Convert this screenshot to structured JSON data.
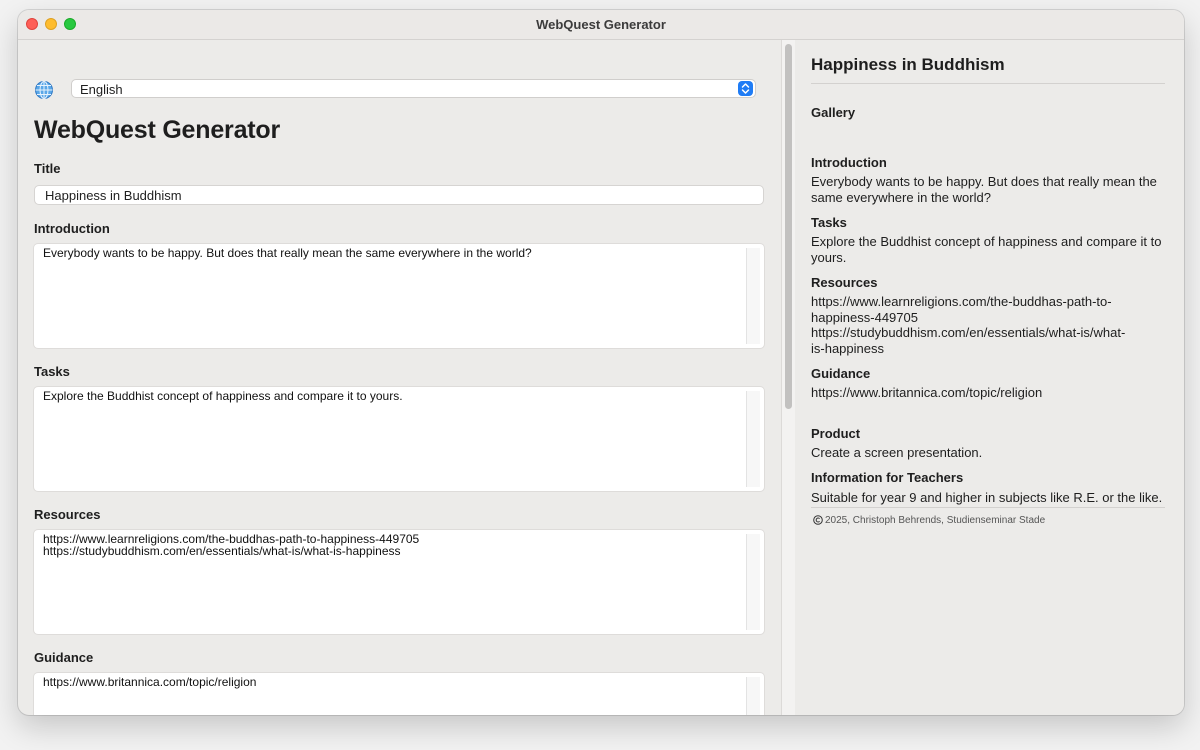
{
  "window": {
    "title": "WebQuest Generator"
  },
  "language": {
    "selected": "English"
  },
  "form": {
    "heading": "WebQuest Generator",
    "title_label": "Title",
    "title_value": "Happiness in Buddhism",
    "introduction_label": "Introduction",
    "introduction_value": "Everybody wants to be happy. But does that really mean the same everywhere in the world?",
    "tasks_label": "Tasks",
    "tasks_value": "Explore the Buddhist concept of happiness and compare it to yours.",
    "resources_label": "Resources",
    "resources_value": "https://www.learnreligions.com/the-buddhas-path-to-happiness-449705\nhttps://studybuddhism.com/en/essentials/what-is/what-is-happiness",
    "guidance_label": "Guidance",
    "guidance_value": "https://www.britannica.com/topic/religion"
  },
  "preview": {
    "title": "Happiness in Buddhism",
    "gallery_heading": "Gallery",
    "introduction_heading": "Introduction",
    "introduction_text": "Everybody wants to be happy. But does that really mean the same everywhere in the world?",
    "tasks_heading": "Tasks",
    "tasks_text": "Explore the Buddhist concept of happiness and compare it to yours.",
    "resources_heading": "Resources",
    "resources_line1": "https://www.learnreligions.com/the-buddhas-path-to-",
    "resources_line2": "happiness-449705",
    "resources_line3": "https://studybuddhism.com/en/essentials/what-is/what-",
    "resources_line4": "is-happiness",
    "guidance_heading": "Guidance",
    "guidance_text": "https://www.britannica.com/topic/religion",
    "product_heading": "Product",
    "product_text": "Create a screen presentation.",
    "teachers_heading": "Information for Teachers",
    "teachers_text": "Suitable for year 9 and higher in subjects like R.E. or the like.",
    "copyright": "2025, Christoph Behrends, Studienseminar Stade"
  },
  "icons": {
    "language": "globe-icon",
    "copyright": "copyright-icon",
    "select": "chevron-up-down-icon"
  },
  "colors": {
    "accent": "#1f7cf5",
    "close": "#fe5f57",
    "minimize": "#febc2e",
    "zoom": "#28c840"
  }
}
